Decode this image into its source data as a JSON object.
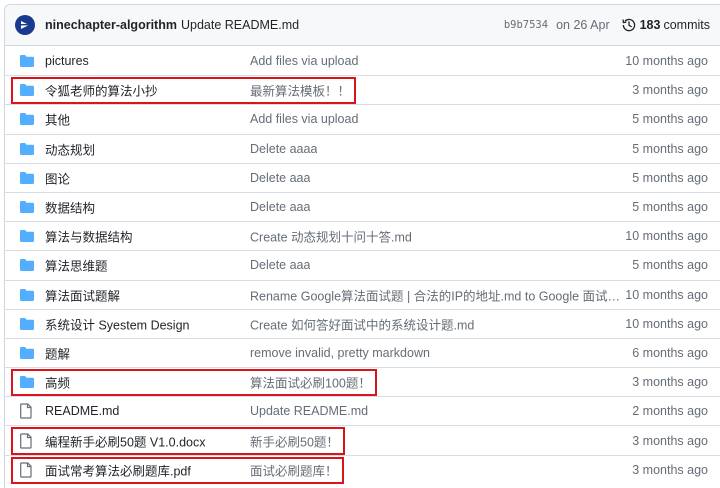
{
  "commit": {
    "owner": "ninechapter-algorithm",
    "message": "Update README.md",
    "sha": "b9b7534",
    "date": "on 26 Apr",
    "commit_count": "183",
    "commits_label": "commits"
  },
  "files": [
    {
      "type": "dir",
      "name": "pictures",
      "message": "Add files via upload",
      "age": "10 months ago",
      "highlighted": false
    },
    {
      "type": "dir",
      "name": "令狐老师的算法小抄",
      "message": "最新算法模板！！",
      "age": "3 months ago",
      "highlighted": true
    },
    {
      "type": "dir",
      "name": "其他",
      "message": "Add files via upload",
      "age": "5 months ago",
      "highlighted": false
    },
    {
      "type": "dir",
      "name": "动态规划",
      "message": "Delete aaaa",
      "age": "5 months ago",
      "highlighted": false
    },
    {
      "type": "dir",
      "name": "图论",
      "message": "Delete aaa",
      "age": "5 months ago",
      "highlighted": false
    },
    {
      "type": "dir",
      "name": "数据结构",
      "message": "Delete aaa",
      "age": "5 months ago",
      "highlighted": false
    },
    {
      "type": "dir",
      "name": "算法与数据结构",
      "message": "Create 动态规划十问十答.md",
      "age": "10 months ago",
      "highlighted": false
    },
    {
      "type": "dir",
      "name": "算法思维题",
      "message": "Delete aaa",
      "age": "5 months ago",
      "highlighted": false
    },
    {
      "type": "dir",
      "name": "算法面试题解",
      "message": "Rename Google算法面试题 | 合法的IP的地址.md to Google 面试题 | 合法的IP的地址.md",
      "age": "10 months ago",
      "highlighted": false
    },
    {
      "type": "dir",
      "name": "系统设计 Syestem Design",
      "message": "Create 如何答好面试中的系统设计题.md",
      "age": "10 months ago",
      "highlighted": false
    },
    {
      "type": "dir",
      "name": "题解",
      "message": "remove invalid, pretty markdown",
      "age": "6 months ago",
      "highlighted": false
    },
    {
      "type": "dir",
      "name": "高频",
      "message": "算法面试必刷100题！",
      "age": "3 months ago",
      "highlighted": true
    },
    {
      "type": "file",
      "name": "README.md",
      "message": "Update README.md",
      "age": "2 months ago",
      "highlighted": false
    },
    {
      "type": "file",
      "name": "编程新手必刷50题 V1.0.docx",
      "message": "新手必刷50题！",
      "age": "3 months ago",
      "highlighted": true
    },
    {
      "type": "file",
      "name": "面试常考算法必刷题库.pdf",
      "message": "面试必刷题库！",
      "age": "3 months ago",
      "highlighted": true
    }
  ],
  "colors": {
    "folder": "#54aeff",
    "file_icon": "#656d76",
    "highlight": "#d9141b",
    "avatar": "#1a3a8f"
  }
}
